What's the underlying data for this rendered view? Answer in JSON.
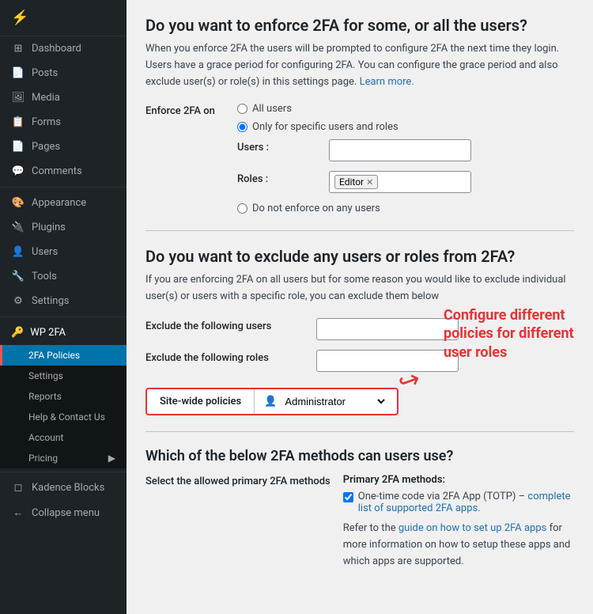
{
  "sidebar": {
    "logo": "⚡",
    "items": [
      {
        "id": "dashboard",
        "icon": "⊞",
        "label": "Dashboard"
      },
      {
        "id": "posts",
        "icon": "📄",
        "label": "Posts"
      },
      {
        "id": "media",
        "icon": "🖼",
        "label": "Media"
      },
      {
        "id": "forms",
        "icon": "📋",
        "label": "Forms"
      },
      {
        "id": "pages",
        "icon": "📄",
        "label": "Pages"
      },
      {
        "id": "comments",
        "icon": "💬",
        "label": "Comments"
      },
      {
        "id": "appearance",
        "icon": "🎨",
        "label": "Appearance"
      },
      {
        "id": "plugins",
        "icon": "🔌",
        "label": "Plugins"
      },
      {
        "id": "users",
        "icon": "👤",
        "label": "Users"
      },
      {
        "id": "tools",
        "icon": "🔧",
        "label": "Tools"
      },
      {
        "id": "settings",
        "icon": "⚙",
        "label": "Settings"
      }
    ],
    "wp2fa": {
      "label": "WP 2FA",
      "icon": "🔑",
      "submenu": [
        {
          "id": "2fa-policies",
          "label": "2FA Policies",
          "active": true
        },
        {
          "id": "settings",
          "label": "Settings"
        },
        {
          "id": "reports",
          "label": "Reports"
        },
        {
          "id": "help-contact",
          "label": "Help & Contact Us"
        },
        {
          "id": "account",
          "label": "Account"
        },
        {
          "id": "pricing",
          "label": "Pricing",
          "hasArrow": true
        }
      ]
    },
    "kadence": {
      "icon": "◻",
      "label": "Kadence Blocks"
    },
    "collapse": {
      "icon": "←",
      "label": "Collapse menu"
    }
  },
  "main": {
    "enforce_section": {
      "title": "Do you want to enforce 2FA for some, or all the users?",
      "description": "When you enforce 2FA the users will be prompted to configure 2FA the next time they login. Users have a grace period for configuring 2FA. You can configure the grace period and also exclude user(s) or role(s) in this settings page.",
      "learn_more": "Learn more.",
      "enforce_label": "Enforce 2FA on",
      "radio_all": "All users",
      "radio_specific": "Only for specific users and roles",
      "radio_none": "Do not enforce on any users",
      "users_label": "Users :",
      "roles_label": "Roles :",
      "role_tag": "Editor"
    },
    "exclude_section": {
      "title": "Do you want to exclude any users or roles from 2FA?",
      "description": "If you are enforcing 2FA on all users but for some reason you would like to exclude individual user(s) or users with a specific role, you can exclude them below",
      "exclude_users_label": "Exclude the following users",
      "exclude_roles_label": "Exclude the following roles"
    },
    "callout": {
      "text": "Configure different policies for different user roles",
      "arrow": "↩"
    },
    "policy_bar": {
      "tab_label": "Site-wide policies",
      "dropdown_label": "Administrator",
      "dropdown_icon": "👤"
    },
    "methods_section": {
      "title": "Which of the below 2FA methods can users use?",
      "select_label": "Select the allowed primary 2FA methods",
      "primary_title": "Primary 2FA methods:",
      "totp_label": "One-time code via 2FA App (TOTP) –",
      "totp_link": "complete list of supported 2FA apps.",
      "methods_note_pre": "Refer to the",
      "methods_note_link": "guide on how to set up 2FA apps",
      "methods_note_post": "for more information on how to setup these apps and which apps are supported."
    }
  }
}
